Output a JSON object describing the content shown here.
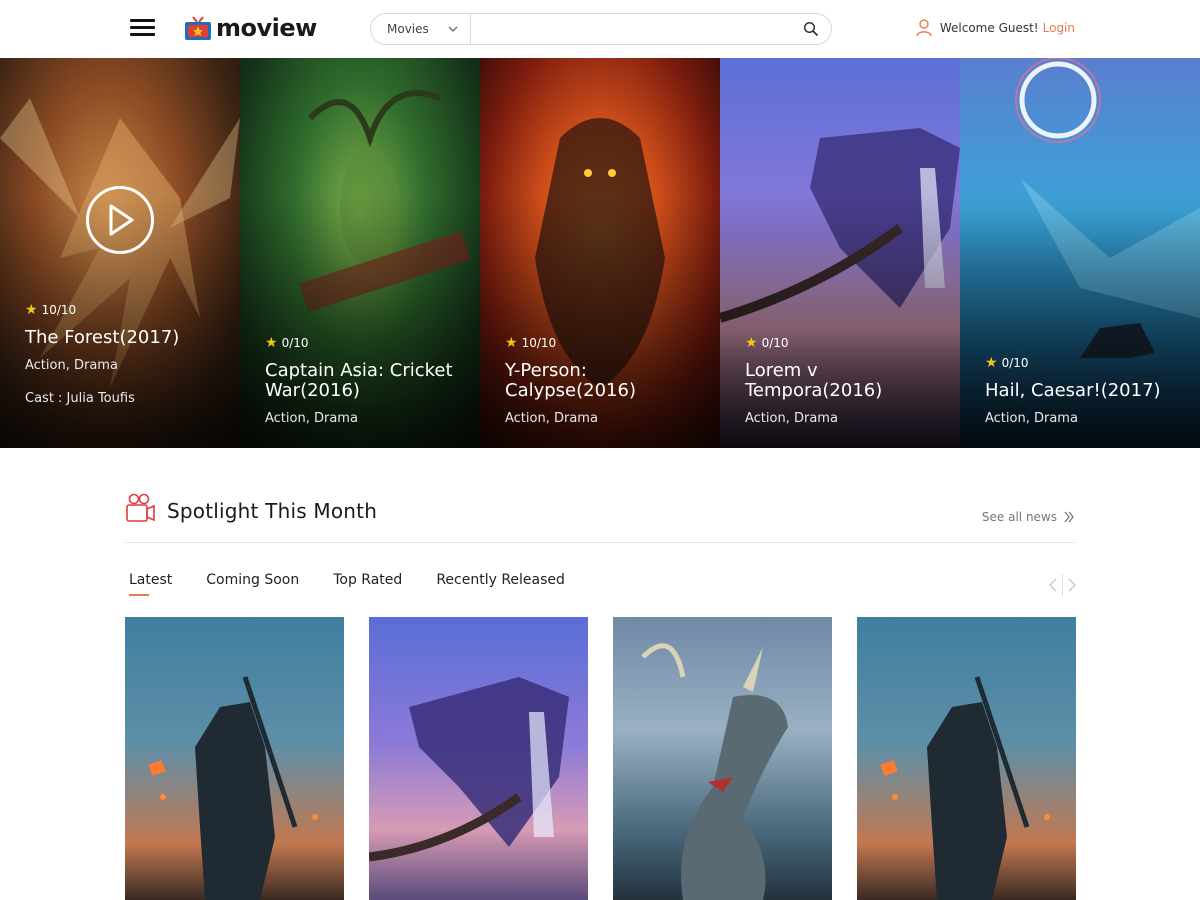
{
  "header": {
    "logo_text": "moview",
    "search": {
      "category": "Movies",
      "placeholder": ""
    },
    "user": {
      "welcome": "Welcome Guest!",
      "login": "Login"
    }
  },
  "hero": {
    "slides": [
      {
        "rating": "10/10",
        "title": "The Forest(2017)",
        "genre": "Action, Drama",
        "cast": "Cast : Julia Toufis"
      },
      {
        "rating": "0/10",
        "title": "Captain Asia: Cricket War(2016)",
        "genre": "Action, Drama"
      },
      {
        "rating": "10/10",
        "title": "Y-Person: Calypse(2016)",
        "genre": "Action, Drama"
      },
      {
        "rating": "0/10",
        "title": "Lorem v Tempora(2016)",
        "genre": "Action, Drama"
      },
      {
        "rating": "0/10",
        "title": "Hail, Caesar!(2017)",
        "genre": "Action, Drama"
      }
    ]
  },
  "spotlight": {
    "title": "Spotlight This Month",
    "see_all": "See all news",
    "tabs": [
      "Latest",
      "Coming Soon",
      "Top Rated",
      "Recently Released"
    ]
  },
  "colors": {
    "accent": "#e87b4d",
    "star": "#f5c518"
  }
}
